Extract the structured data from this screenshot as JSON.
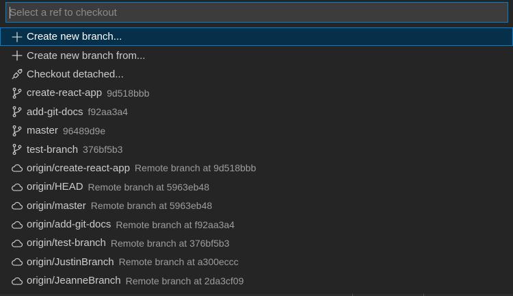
{
  "search": {
    "placeholder": "Select a ref to checkout",
    "value": ""
  },
  "colors": {
    "background": "#252526",
    "focus_border": "#007fd4",
    "selection": "#062f4a",
    "text": "#cccccc",
    "description": "#9d9d9d"
  },
  "items": [
    {
      "icon": "plus-icon",
      "label": "Create new branch...",
      "description": ""
    },
    {
      "icon": "plus-icon",
      "label": "Create new branch from...",
      "description": ""
    },
    {
      "icon": "debug-disconnect-icon",
      "label": "Checkout detached...",
      "description": ""
    },
    {
      "icon": "git-branch-icon",
      "label": "create-react-app",
      "description": "9d518bbb"
    },
    {
      "icon": "git-branch-icon",
      "label": "add-git-docs",
      "description": "f92aa3a4"
    },
    {
      "icon": "git-branch-icon",
      "label": "master",
      "description": "96489d9e"
    },
    {
      "icon": "git-branch-icon",
      "label": "test-branch",
      "description": "376bf5b3"
    },
    {
      "icon": "cloud-icon",
      "label": "origin/create-react-app",
      "description": "Remote branch at 9d518bbb"
    },
    {
      "icon": "cloud-icon",
      "label": "origin/HEAD",
      "description": "Remote branch at 5963eb48"
    },
    {
      "icon": "cloud-icon",
      "label": "origin/master",
      "description": "Remote branch at 5963eb48"
    },
    {
      "icon": "cloud-icon",
      "label": "origin/add-git-docs",
      "description": "Remote branch at f92aa3a4"
    },
    {
      "icon": "cloud-icon",
      "label": "origin/test-branch",
      "description": "Remote branch at 376bf5b3"
    },
    {
      "icon": "cloud-icon",
      "label": "origin/JustinBranch",
      "description": "Remote branch at a300eccc"
    },
    {
      "icon": "cloud-icon",
      "label": "origin/JeanneBranch",
      "description": "Remote branch at 2da3cf09"
    }
  ]
}
